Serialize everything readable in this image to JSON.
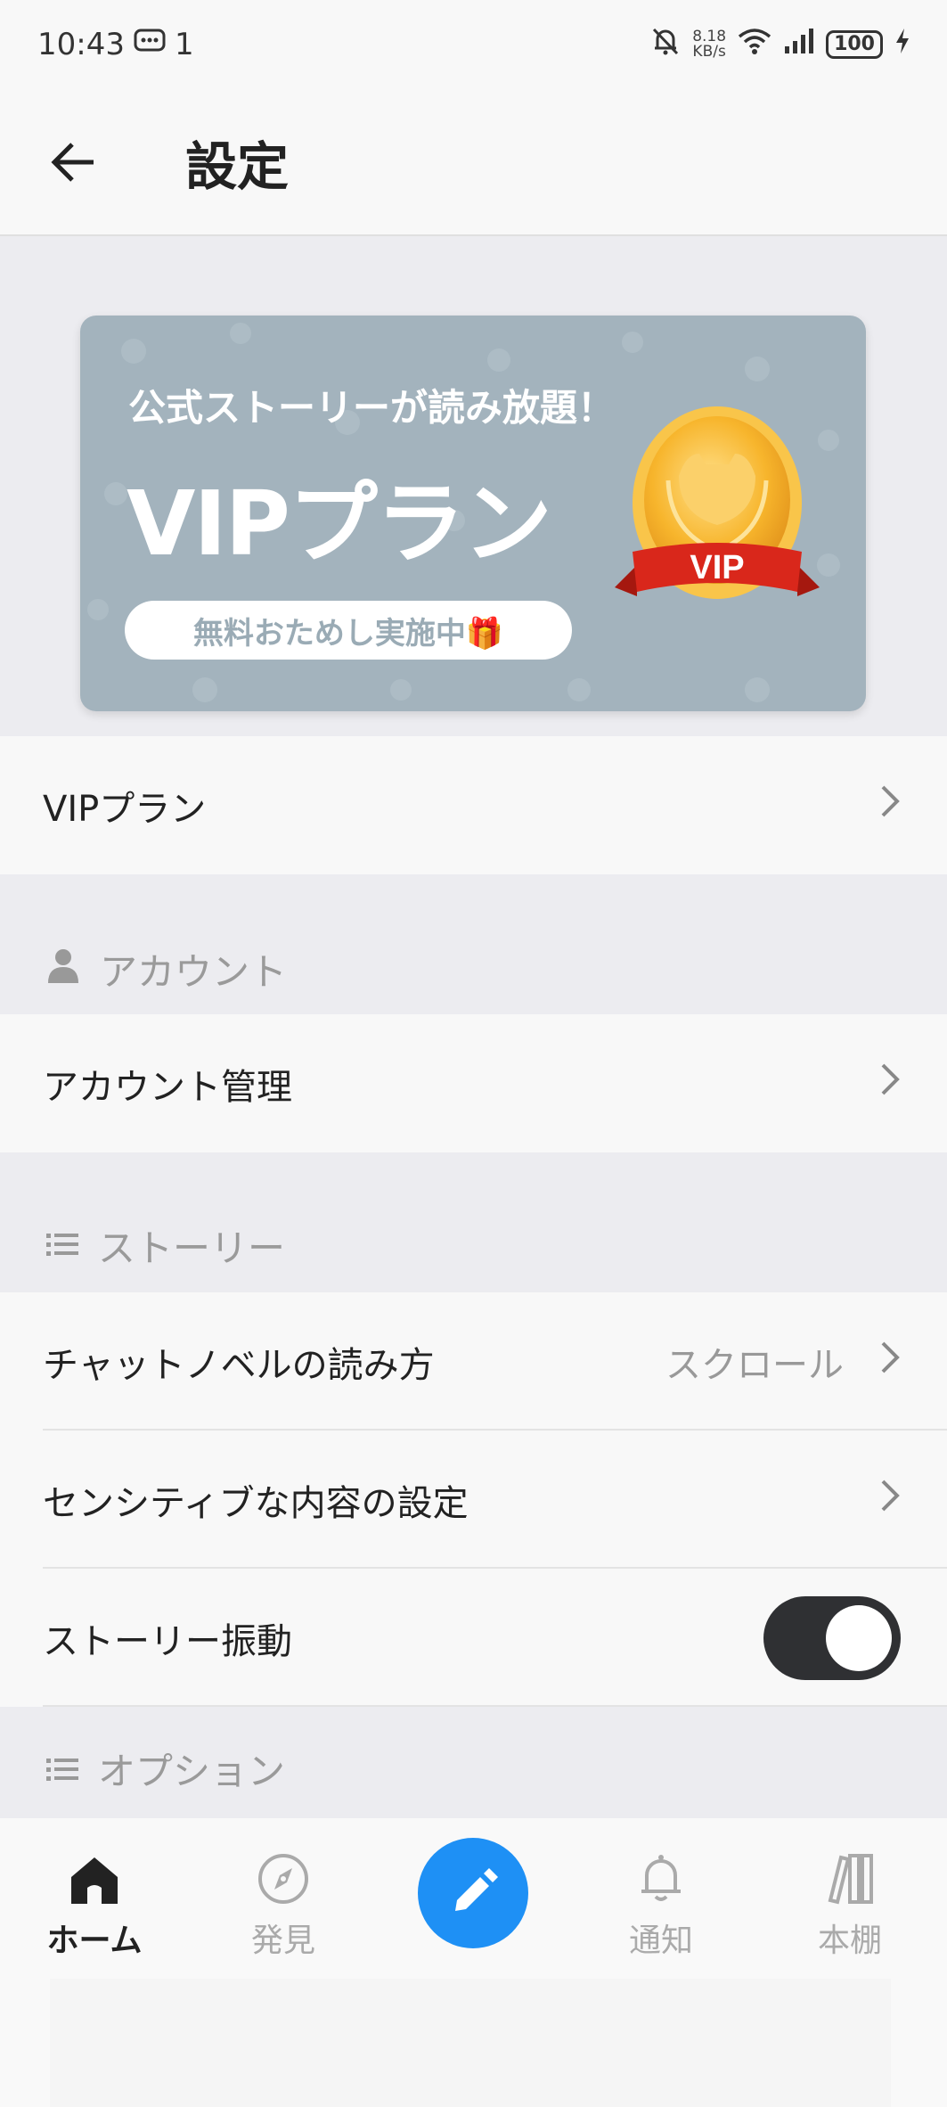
{
  "status_bar": {
    "time": "10:43",
    "notif_count": "1",
    "net_speed_value": "8.18",
    "net_speed_unit": "KB/s",
    "battery": "100"
  },
  "app_bar": {
    "title": "設定"
  },
  "banner": {
    "subtitle": "公式ストーリーが読み放題！",
    "title": "VIPプラン",
    "pill": "無料おためし実施中🎁",
    "medal_text": "VIP"
  },
  "vip_row": {
    "label": "VIPプラン"
  },
  "sections": {
    "account": {
      "header": "アカウント",
      "items": [
        {
          "label": "アカウント管理"
        }
      ]
    },
    "story": {
      "header": "ストーリー",
      "items": [
        {
          "label": "チャットノベルの読み方",
          "value": "スクロール"
        },
        {
          "label": "センシティブな内容の設定"
        },
        {
          "label": "ストーリー振動",
          "toggle": true
        }
      ]
    },
    "options": {
      "header": "オプション"
    }
  },
  "bottom_nav": {
    "items": [
      {
        "label": "ホーム",
        "icon": "home-icon",
        "active": true
      },
      {
        "label": "発見",
        "icon": "compass-icon"
      },
      {
        "label": "",
        "icon": "pencil-icon"
      },
      {
        "label": "通知",
        "icon": "bell-icon"
      },
      {
        "label": "本棚",
        "icon": "bookshelf-icon"
      }
    ]
  },
  "colors": {
    "accent": "#1e90f5",
    "banner_bg": "#a3b3bd",
    "section_bg": "#ececf0",
    "toggle_on": "#2f3033"
  }
}
